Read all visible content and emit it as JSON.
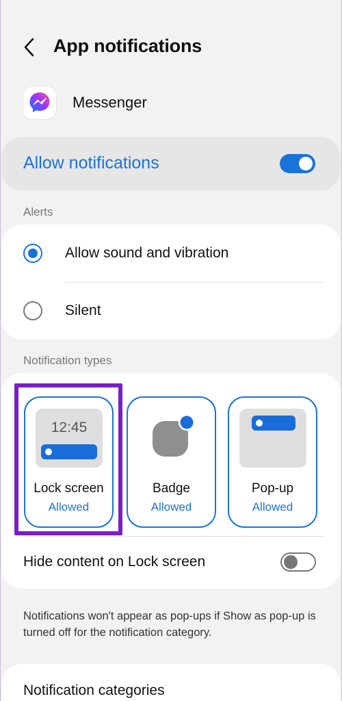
{
  "header": {
    "title": "App notifications",
    "back_icon": "chevron-left-icon"
  },
  "app": {
    "name": "Messenger",
    "icon": "messenger-icon"
  },
  "allow": {
    "label": "Allow notifications",
    "enabled": true
  },
  "alerts": {
    "section_label": "Alerts",
    "options": [
      {
        "label": "Allow sound and vibration",
        "selected": true
      },
      {
        "label": "Silent",
        "selected": false
      }
    ]
  },
  "notification_types": {
    "section_label": "Notification types",
    "tiles": [
      {
        "name": "Lock screen",
        "status": "Allowed",
        "preview_time": "12:45"
      },
      {
        "name": "Badge",
        "status": "Allowed"
      },
      {
        "name": "Pop-up",
        "status": "Allowed"
      }
    ],
    "hide_content": {
      "label": "Hide content on Lock screen",
      "enabled": false
    }
  },
  "note": "Notifications won't appear as pop-ups if Show as pop-up is turned off for the notification category.",
  "categories": {
    "label": "Notification categories"
  },
  "colors": {
    "accent": "#1a73d9",
    "highlight": "#7a1fc7",
    "background": "#f2f2f2"
  }
}
